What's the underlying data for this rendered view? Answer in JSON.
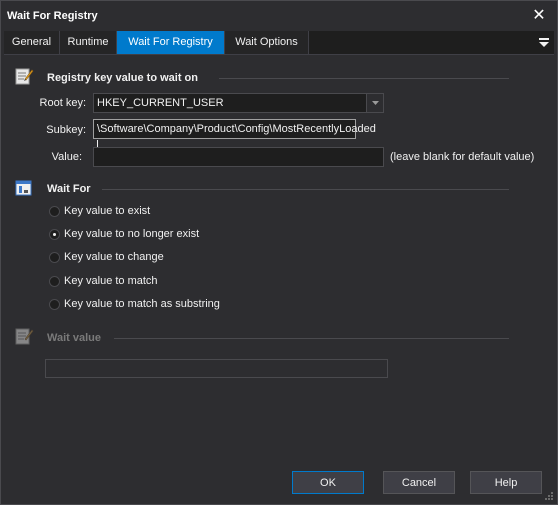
{
  "window": {
    "title": "Wait For Registry",
    "close_glyph": "✕"
  },
  "tabs": [
    {
      "label": "General"
    },
    {
      "label": "Runtime"
    },
    {
      "label": "Wait For Registry",
      "active": true
    },
    {
      "label": "Wait Options"
    }
  ],
  "registry_section": {
    "title": "Registry key value to wait on",
    "icon": "registry-edit-icon",
    "root_key": {
      "label": "Root key:",
      "value": "HKEY_CURRENT_USER"
    },
    "subkey": {
      "label": "Subkey:",
      "value": "\\Software\\Company\\Product\\Config\\MostRecentlyLoaded"
    },
    "value": {
      "label": "Value:",
      "value": "",
      "hint": "(leave blank for default value)"
    }
  },
  "wait_for_section": {
    "title": "Wait For",
    "icon": "window-wait-icon",
    "options": [
      {
        "label": "Key value to exist",
        "checked": false
      },
      {
        "label": "Key value to no longer exist",
        "checked": true
      },
      {
        "label": "Key value to change",
        "checked": false
      },
      {
        "label": "Key value to match",
        "checked": false
      },
      {
        "label": "Key value to match as substring",
        "checked": false
      }
    ]
  },
  "wait_value_section": {
    "title": "Wait value",
    "icon": "registry-edit-icon",
    "value": "",
    "disabled": true
  },
  "buttons": {
    "ok": "OK",
    "cancel": "Cancel",
    "help": "Help"
  },
  "colors": {
    "background": "#2d2d30",
    "accent": "#007acc",
    "field": "#1e1e1e"
  }
}
